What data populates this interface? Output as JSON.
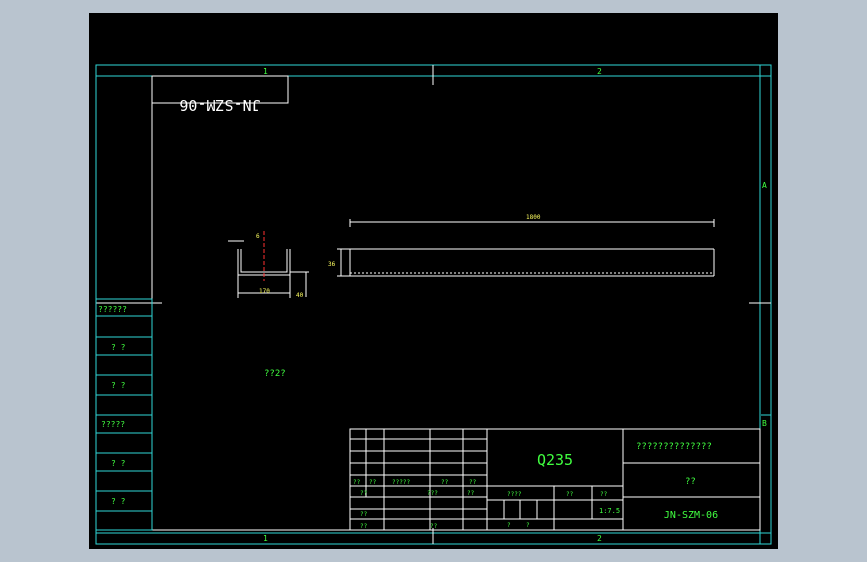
{
  "drawing": {
    "mirrored_code": "JN-SZM-06",
    "zone_top_left": "1",
    "zone_top_right": "2",
    "zone_bottom_left": "1",
    "zone_bottom_right": "2",
    "zone_right_a": "A",
    "zone_right_b": "B",
    "side_labels": [
      "??????",
      "? ?",
      "? ?",
      "?????",
      "? ?",
      "? ?"
    ],
    "note": "??2?",
    "dims": {
      "length": "1800",
      "height": "36",
      "flange": "6",
      "width": "170",
      "tab": "40"
    },
    "title_block": {
      "material": "Q235",
      "company": "??????????????",
      "part_name": "??",
      "drawing_no": "JN-SZM-06",
      "scale": "1:7.5",
      "row_sign": [
        "??",
        "??",
        "?????",
        "??",
        "??"
      ],
      "row_a": [
        "??",
        "???",
        "??"
      ],
      "row_c": [
        "??"
      ],
      "row_d": [
        "??",
        "??"
      ],
      "stage_header": [
        "????",
        "??",
        "??"
      ],
      "stage_bottom": [
        "?",
        "?"
      ]
    }
  },
  "colors": {
    "frame": "#2fd7d7",
    "text": "#40ff40",
    "geometry": "#ffffff",
    "centerline": "#ff3030",
    "background": "#000000"
  }
}
